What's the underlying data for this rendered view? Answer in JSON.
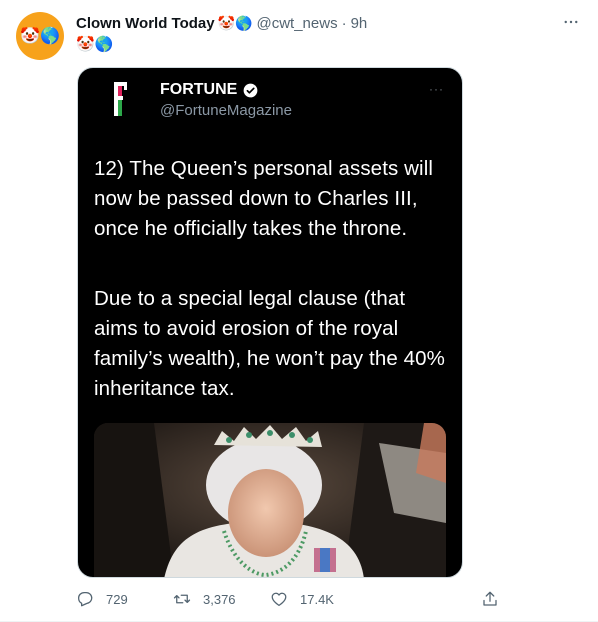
{
  "author": {
    "display_name": "Clown World Today",
    "name_emoji": "🤡🌎",
    "handle": "@cwt_news",
    "separator": "·",
    "time": "9h",
    "avatar_emoji": "🤡🌎"
  },
  "tweet": {
    "text": "🤡🌎"
  },
  "media": {
    "source_name": "FORTUNE",
    "source_handle": "@FortuneMagazine",
    "more": "···",
    "paragraph_1": "12) The Queen’s personal assets will now be passed down to Charles III, once he officially takes the throne.",
    "paragraph_2": "Due to a special legal clause (that aims to avoid erosion of the royal family’s wealth), he won’t pay the 40% inheritance tax."
  },
  "actions": {
    "replies": "729",
    "retweets": "3,376",
    "likes": "17.4K"
  },
  "colors": {
    "verified": "#1d9bf0",
    "secondary_text": "#536471",
    "media_bg": "#000000"
  }
}
